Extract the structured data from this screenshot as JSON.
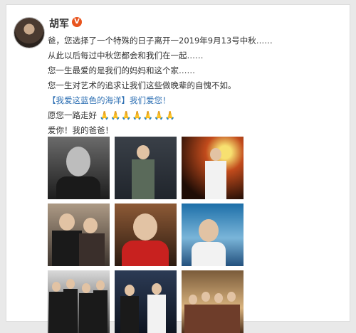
{
  "post": {
    "username": "胡军",
    "verified_icon": "verified-v-badge-icon",
    "lines": [
      "爸，您选择了一个特殊的日子离开一2019年9月13号中秋……",
      "从此以后每过中秋您都会和我们在一起……",
      "您一生最爱的是我们的妈妈和这个家……",
      "您一生对艺术的追求让我们这些做晚辈的自愧不如。",
      "【我爱这蓝色的海洋】我们爱您！",
      "愿您一路走好",
      "爱你！我的爸爸！"
    ],
    "pray_emojis": "🙏🙏🙏🙏🙏🙏🙏"
  },
  "photos": [
    {
      "name": "portrait-uniform-bw"
    },
    {
      "name": "stage-performer-uniform"
    },
    {
      "name": "stage-performer-fire"
    },
    {
      "name": "couple-portrait"
    },
    {
      "name": "man-red-scarf"
    },
    {
      "name": "album-cover-blue-sea"
    },
    {
      "name": "family-group-bw"
    },
    {
      "name": "stage-duet"
    },
    {
      "name": "family-gathering"
    }
  ],
  "colors": {
    "accent_blue": "#2d6fb3",
    "verified_orange": "#e8541e",
    "text": "#333333"
  }
}
